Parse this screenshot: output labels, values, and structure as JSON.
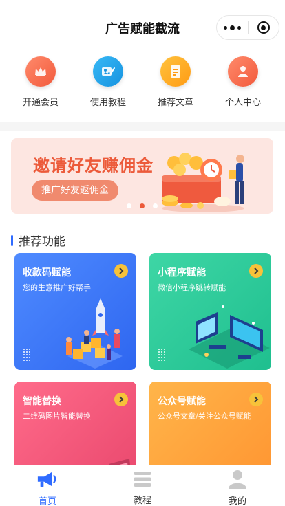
{
  "header": {
    "title": "广告赋能截流"
  },
  "quick_links": [
    {
      "label": "开通会员",
      "icon": "crown-icon",
      "color_from": "#ff8a6b",
      "color_to": "#f25a3c"
    },
    {
      "label": "使用教程",
      "icon": "tutorial-icon",
      "color_from": "#38b8f5",
      "color_to": "#1693e0"
    },
    {
      "label": "推荐文章",
      "icon": "article-icon",
      "color_from": "#ffc23d",
      "color_to": "#ff9b14"
    },
    {
      "label": "个人中心",
      "icon": "user-icon",
      "color_from": "#ff8a6b",
      "color_to": "#f25a3c"
    }
  ],
  "banner": {
    "title": "邀请好友赚佣金",
    "button": "推广好友返佣金",
    "slides": 3,
    "active_slide": 2
  },
  "section": {
    "title": "推荐功能"
  },
  "cards": [
    {
      "title": "收款码赋能",
      "desc": "您的生意推广好帮手",
      "color_from": "#4f8bff",
      "color_to": "#2e66f0"
    },
    {
      "title": "小程序赋能",
      "desc": "微信小程序跳转赋能",
      "color_from": "#3ed6a5",
      "color_to": "#1fbf8f"
    },
    {
      "title": "智能替换",
      "desc": "二维码图片智能替换",
      "color_from": "#ff6b8a",
      "color_to": "#e8466c"
    },
    {
      "title": "公众号赋能",
      "desc": "公众号文章/关注公众号赋能",
      "color_from": "#ffb54a",
      "color_to": "#ff9330"
    }
  ],
  "tabbar": [
    {
      "label": "首页",
      "icon": "megaphone-icon",
      "active": true
    },
    {
      "label": "教程",
      "icon": "list-icon",
      "active": false
    },
    {
      "label": "我的",
      "icon": "user-icon",
      "active": false
    }
  ],
  "colors": {
    "accent": "#2f6bff",
    "banner_red": "#ec5a3a",
    "arrow_yellow": "#f7c23a"
  }
}
